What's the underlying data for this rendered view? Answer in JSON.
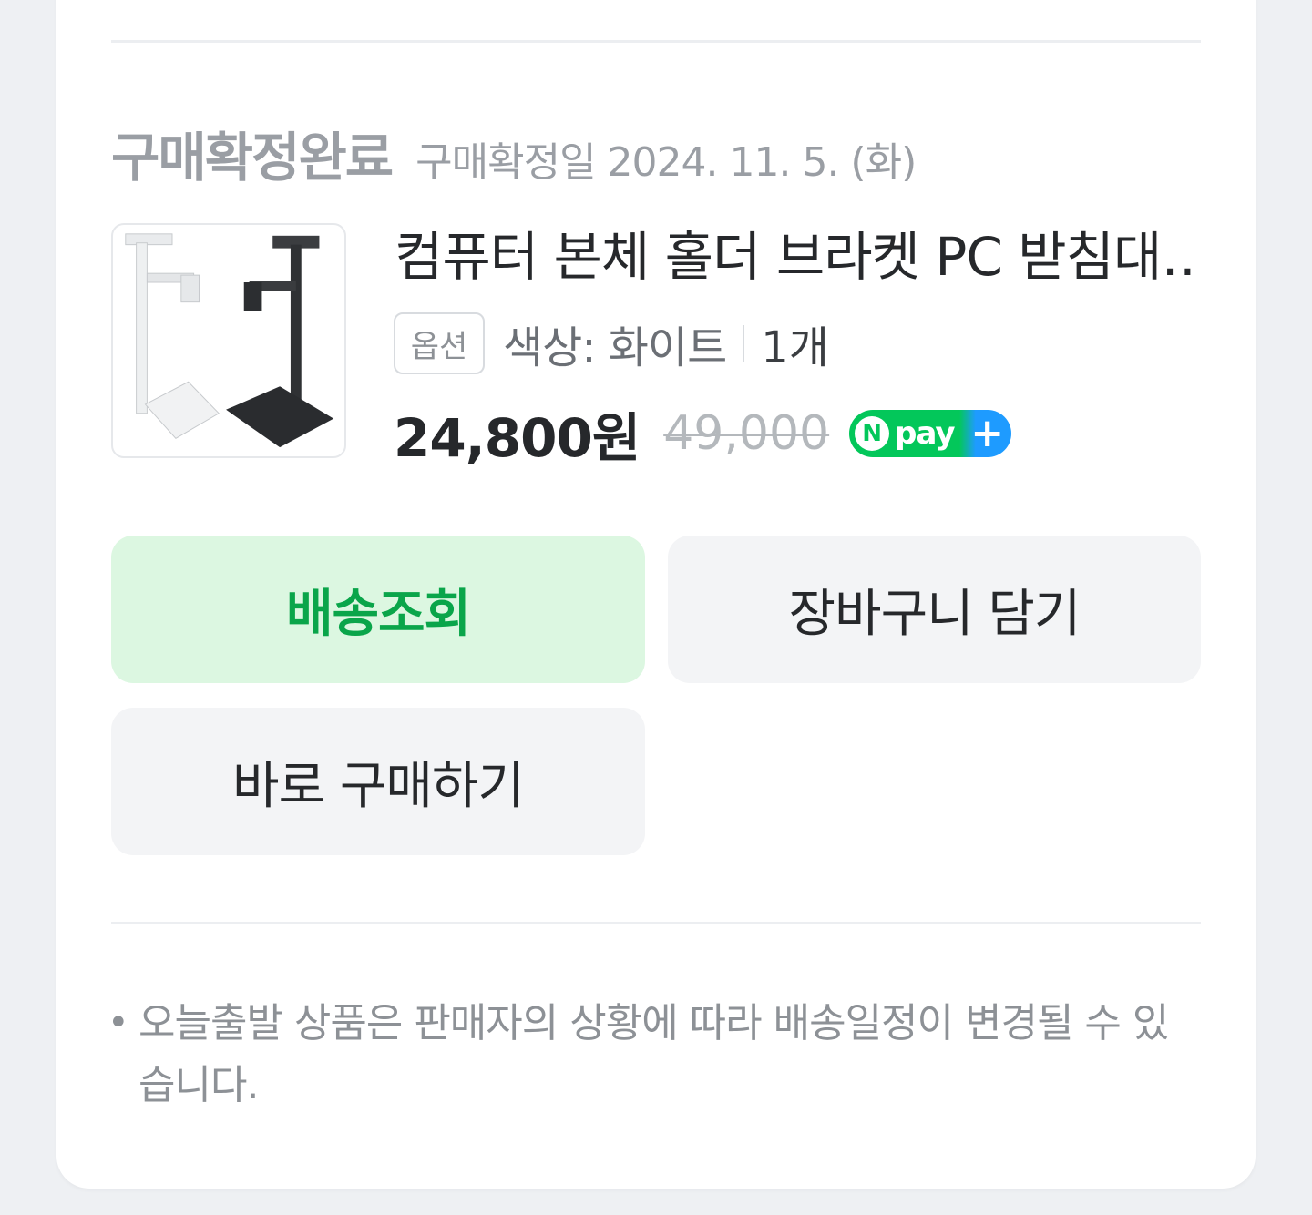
{
  "order": {
    "status": "구매확정완료",
    "confirmed_date": "구매확정일 2024. 11. 5. (화)"
  },
  "product": {
    "image_icon": "pc-stand-bracket-photo",
    "name": "컴퓨터 본체 홀더 브라켓 PC 받침대…",
    "option_badge": "옵션",
    "option_text": "색상: 화이트",
    "quantity": "1개",
    "price": "24,800원",
    "original_price": "49,000",
    "npay_badge": {
      "n": "N",
      "text": "pay",
      "plus": "+"
    }
  },
  "actions": {
    "track_label": "배송조회",
    "cart_label": "장바구니 담기",
    "buy_label": "바로 구매하기"
  },
  "notice": {
    "bullet": "•",
    "text": "오늘출발 상품은 판매자의 상황에 따라 배송일정이 변경될 수 있습니다."
  },
  "colors": {
    "accent_green": "#0aa54a",
    "track_bg": "#dcf7e1",
    "npay_green": "#03c75a",
    "npay_blue": "#1e9bff"
  }
}
